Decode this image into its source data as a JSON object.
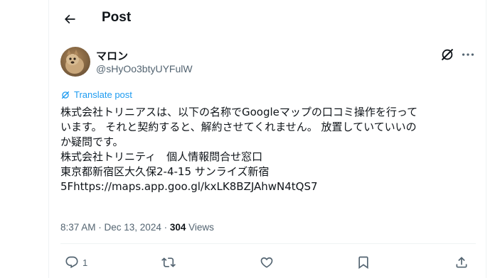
{
  "header": {
    "title": "Post",
    "back_icon": "arrow-left-icon"
  },
  "author": {
    "name": "マロン",
    "handle": "@sHyOo3btyUYFulW"
  },
  "translate_label": "Translate post",
  "tweet_lines": [
    "株式会社トリニアスは、以下の名称でGoogleマップの口コミ操作を行って",
    "います。 それと契約すると、解約させてくれません。 放置していていいの",
    "か疑問です。",
    "株式会社トリニティ　個人情報問合せ窓口",
    "東京都新宿区大久保2-4-15 サンライズ新宿",
    "5Fhttps://maps.app.goo.gl/kxLK8BZJAhwN4tQS7"
  ],
  "meta": {
    "timestamp": "8:37 AM · Dec 13, 2024 · ",
    "views_count": "304",
    "views_label": " Views"
  },
  "actions": {
    "reply_count": "1",
    "icons": [
      "reply-icon",
      "repost-icon",
      "like-icon",
      "bookmark-icon",
      "share-icon"
    ]
  },
  "colors": {
    "accent": "#1d9bf0",
    "text": "#0f1419",
    "secondary": "#536471"
  }
}
